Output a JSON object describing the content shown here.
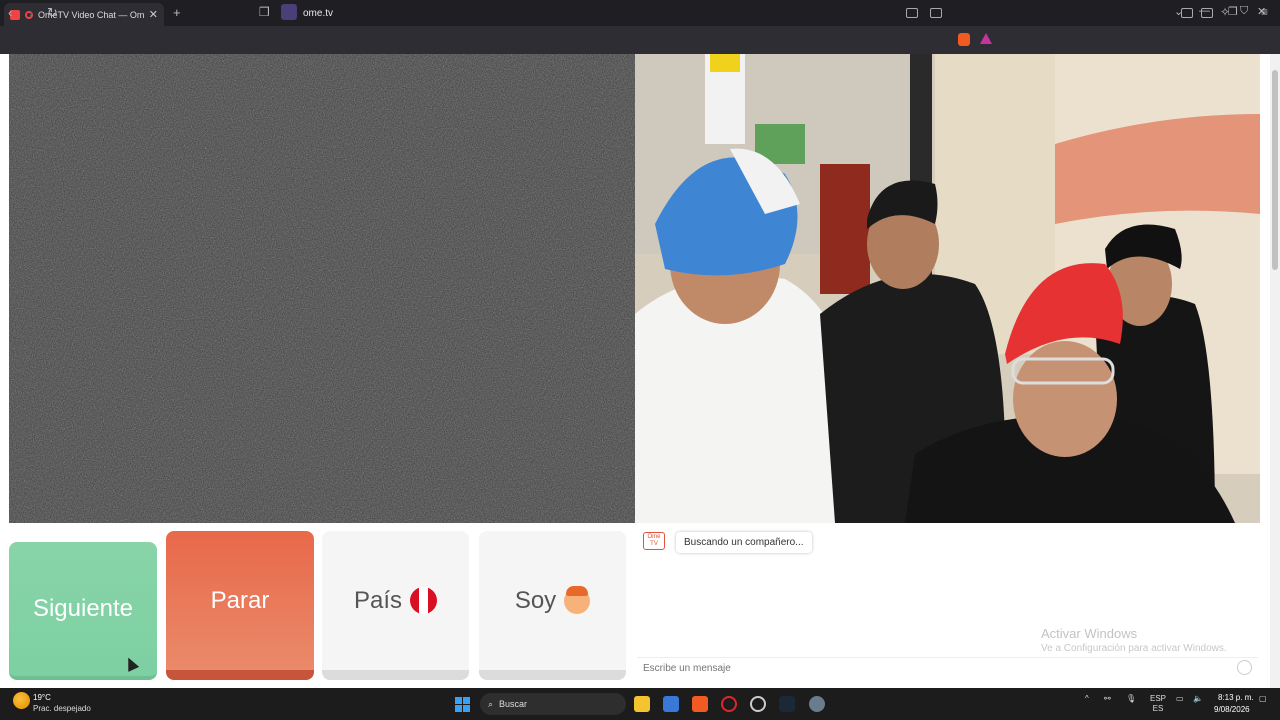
{
  "browser": {
    "tab_title": "OmeTV Video Chat — Omegle",
    "new_tab_symbol": "+",
    "url": "ome.tv"
  },
  "controls": {
    "next_label": "Siguiente",
    "stop_label": "Parar",
    "country_label": "País",
    "gender_label": "Soy"
  },
  "chat": {
    "logo_text": "Ome TV",
    "status_message": "Buscando un compañero...",
    "input_placeholder": "Escribe un mensaje"
  },
  "watermark": {
    "line1": "Activar Windows",
    "line2": "Ve a Configuración para activar Windows."
  },
  "taskbar": {
    "temperature": "19°C",
    "weather": "Prac. despejado",
    "search_label": "Buscar",
    "lang_primary": "ESP",
    "lang_secondary": "ES",
    "time": "8:13 p. m.",
    "date": "9/08/2026"
  },
  "colors": {
    "next": "#7dd0a3",
    "stop": "#e8694a",
    "neutral": "#f5f5f5",
    "flag_red": "#d91023"
  }
}
